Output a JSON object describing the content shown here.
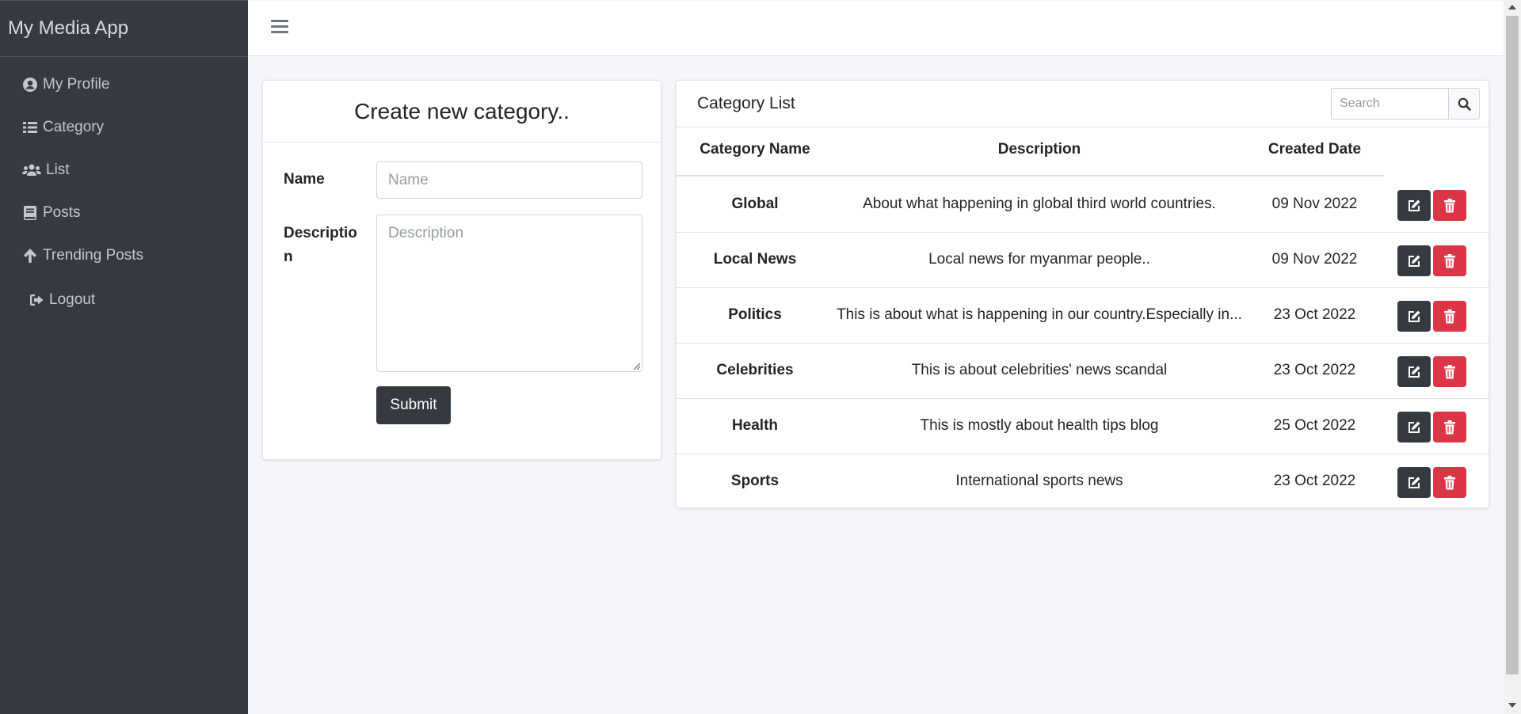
{
  "app": {
    "brand": "My Media App"
  },
  "sidebar": {
    "items": [
      {
        "label": "My Profile",
        "icon": "user-circle-icon"
      },
      {
        "label": "Category",
        "icon": "list-icon"
      },
      {
        "label": "List",
        "icon": "users-icon"
      },
      {
        "label": "Posts",
        "icon": "book-icon"
      },
      {
        "label": "Trending Posts",
        "icon": "arrow-up-icon"
      },
      {
        "label": "Logout",
        "icon": "sign-out-icon"
      }
    ]
  },
  "form": {
    "title": "Create new category..",
    "name_label": "Name",
    "name_placeholder": "Name",
    "name_value": "",
    "description_label_1": "Descriptio",
    "description_label_2": "n",
    "description_placeholder": "Description",
    "description_value": "",
    "submit_label": "Submit"
  },
  "list": {
    "title": "Category List",
    "search_placeholder": "Search",
    "columns": [
      "Category Name",
      "Description",
      "Created Date"
    ],
    "rows": [
      {
        "name": "Global",
        "description": "About what happening in global third world countries.",
        "date": "09 Nov 2022"
      },
      {
        "name": "Local News",
        "description": "Local news for myanmar people..",
        "date": "09 Nov 2022"
      },
      {
        "name": "Politics",
        "description": "This is about what is happening in our country.Especially in...",
        "date": "23 Oct 2022"
      },
      {
        "name": "Celebrities",
        "description": "This is about celebrities' news scandal",
        "date": "23 Oct 2022"
      },
      {
        "name": "Health",
        "description": "This is mostly about health tips blog",
        "date": "25 Oct 2022"
      },
      {
        "name": "Sports",
        "description": "International sports news",
        "date": "23 Oct 2022"
      }
    ]
  },
  "colors": {
    "sidebar_bg": "#343a40",
    "sidebar_text": "#c2c7d0",
    "content_bg": "#f4f6f9",
    "edit_button": "#343a40",
    "delete_button": "#dc3545"
  }
}
